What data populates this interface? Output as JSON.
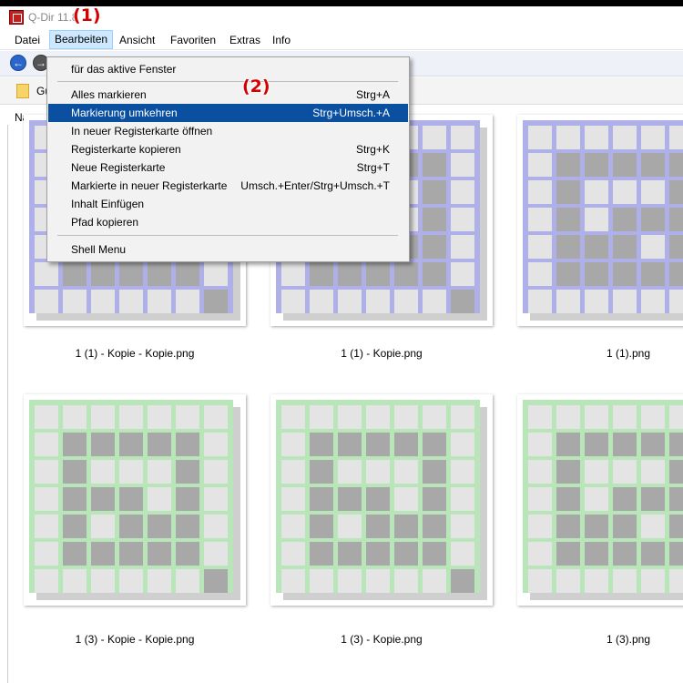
{
  "window": {
    "title": "Q-Dir 11.8"
  },
  "annotations": {
    "a1": "(1)",
    "a2": "(2)"
  },
  "menubar": {
    "items": [
      {
        "label": "Datei"
      },
      {
        "label": "Bearbeiten"
      },
      {
        "label": "Ansicht"
      },
      {
        "label": "Favoriten"
      },
      {
        "label": "Extras"
      },
      {
        "label": "Info"
      }
    ]
  },
  "navbar": {
    "back_icon": "back-arrow-icon",
    "forward_icon": "forward-arrow-icon"
  },
  "tabbar": {
    "tab_label": "Gu"
  },
  "list": {
    "column_name": "Name"
  },
  "dropdown": {
    "items": [
      {
        "label": "für das aktive Fenster",
        "shortcut": ""
      },
      {
        "label": "Alles markieren",
        "shortcut": "Strg+A"
      },
      {
        "label": "Markierung umkehren",
        "shortcut": "Strg+Umsch.+A"
      },
      {
        "label": "In neuer Registerkarte öffnen",
        "shortcut": ""
      },
      {
        "label": "Registerkarte kopieren",
        "shortcut": "Strg+K"
      },
      {
        "label": "Neue Registerkarte",
        "shortcut": "Strg+T"
      },
      {
        "label": "Markierte in neuer Registerkarte",
        "shortcut": "Umsch.+Enter/Strg+Umsch.+T"
      },
      {
        "label": "Inhalt Einfügen",
        "shortcut": ""
      },
      {
        "label": "Pfad kopieren",
        "shortcut": ""
      },
      {
        "label": "Shell Menu",
        "shortcut": ""
      }
    ]
  },
  "files": [
    {
      "name": "1 (1) - Kopie - Kopie.png",
      "color": "#b0b0e8"
    },
    {
      "name": "1 (1) - Kopie.png",
      "color": "#b0b0e8"
    },
    {
      "name": "1 (1).png",
      "color": "#b0b0e8"
    },
    {
      "name": "1 (3) - Kopie - Kopie.png",
      "color": "#b8e6b8"
    },
    {
      "name": "1 (3) - Kopie.png",
      "color": "#b8e6b8"
    },
    {
      "name": "1 (3).png",
      "color": "#b8e6b8"
    }
  ]
}
